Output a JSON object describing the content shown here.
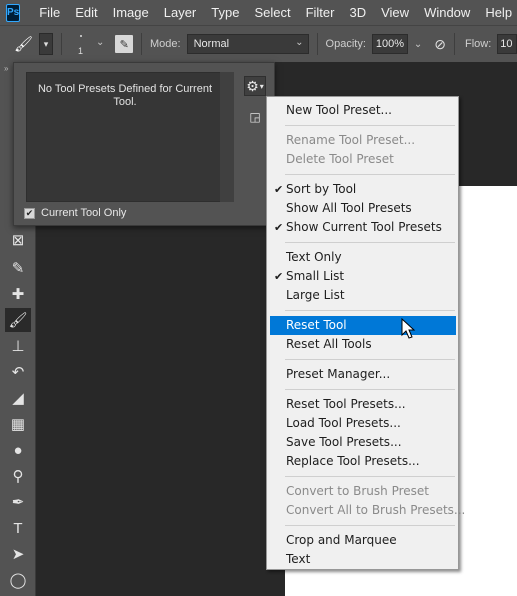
{
  "app": {
    "logo": "Ps"
  },
  "menubar": {
    "items": [
      "File",
      "Edit",
      "Image",
      "Layer",
      "Type",
      "Select",
      "Filter",
      "3D",
      "View",
      "Window",
      "Help"
    ]
  },
  "options": {
    "brush_size": "1",
    "mode_label": "Mode:",
    "mode_value": "Normal",
    "opacity_label": "Opacity:",
    "opacity_value": "100%",
    "flow_label": "Flow:",
    "flow_value": "10"
  },
  "presets_panel": {
    "empty_message": "No Tool Presets Defined for Current Tool.",
    "current_tool_only_label": "Current Tool Only",
    "current_tool_only_checked": true
  },
  "context_menu": {
    "groups": [
      [
        {
          "label": "New Tool Preset...",
          "enabled": true,
          "checked": false
        }
      ],
      [
        {
          "label": "Rename Tool Preset...",
          "enabled": false,
          "checked": false
        },
        {
          "label": "Delete Tool Preset",
          "enabled": false,
          "checked": false
        }
      ],
      [
        {
          "label": "Sort by Tool",
          "enabled": true,
          "checked": true
        },
        {
          "label": "Show All Tool Presets",
          "enabled": true,
          "checked": false
        },
        {
          "label": "Show Current Tool Presets",
          "enabled": true,
          "checked": true
        }
      ],
      [
        {
          "label": "Text Only",
          "enabled": true,
          "checked": false
        },
        {
          "label": "Small List",
          "enabled": true,
          "checked": true
        },
        {
          "label": "Large List",
          "enabled": true,
          "checked": false
        }
      ],
      [
        {
          "label": "Reset Tool",
          "enabled": true,
          "checked": false,
          "highlighted": true
        },
        {
          "label": "Reset All Tools",
          "enabled": true,
          "checked": false
        }
      ],
      [
        {
          "label": "Preset Manager...",
          "enabled": true,
          "checked": false
        }
      ],
      [
        {
          "label": "Reset Tool Presets...",
          "enabled": true,
          "checked": false
        },
        {
          "label": "Load Tool Presets...",
          "enabled": true,
          "checked": false
        },
        {
          "label": "Save Tool Presets...",
          "enabled": true,
          "checked": false
        },
        {
          "label": "Replace Tool Presets...",
          "enabled": true,
          "checked": false
        }
      ],
      [
        {
          "label": "Convert to Brush Preset",
          "enabled": false,
          "checked": false
        },
        {
          "label": "Convert All to Brush Presets...",
          "enabled": false,
          "checked": false
        }
      ],
      [
        {
          "label": "Crop and Marquee",
          "enabled": true,
          "checked": false
        },
        {
          "label": "Text",
          "enabled": true,
          "checked": false
        }
      ]
    ]
  },
  "toolbar": {
    "tools": [
      {
        "name": "crop-icon",
        "glyph": "⊠"
      },
      {
        "name": "eyedropper-icon",
        "glyph": "✎"
      },
      {
        "name": "healing-brush-icon",
        "glyph": "✚"
      },
      {
        "name": "brush-icon",
        "glyph": "🖌",
        "active": true
      },
      {
        "name": "clone-stamp-icon",
        "glyph": "⊥"
      },
      {
        "name": "history-brush-icon",
        "glyph": "↶"
      },
      {
        "name": "eraser-icon",
        "glyph": "◢"
      },
      {
        "name": "gradient-icon",
        "glyph": "▦"
      },
      {
        "name": "blur-icon",
        "glyph": "●"
      },
      {
        "name": "dodge-icon",
        "glyph": "⚲"
      },
      {
        "name": "pen-icon",
        "glyph": "✒"
      },
      {
        "name": "type-icon",
        "glyph": "T"
      },
      {
        "name": "path-selection-icon",
        "glyph": "➤"
      },
      {
        "name": "ellipse-icon",
        "glyph": "◯"
      },
      {
        "name": "hand-icon",
        "glyph": "✋"
      }
    ]
  },
  "colors": {
    "menu_highlight": "#0078d7",
    "ui_gray": "#535353",
    "canvas_dark": "#282828",
    "document": "#ffffff"
  }
}
